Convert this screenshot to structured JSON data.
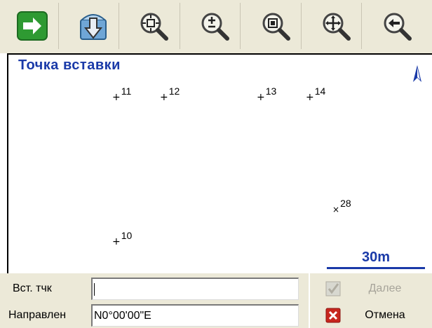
{
  "toolbar": {
    "buttons": [
      {
        "name": "next-arrow-button",
        "icon": "green-arrow-right-icon"
      },
      {
        "name": "save-download-button",
        "icon": "download-arrow-icon"
      },
      {
        "name": "zoom-extents-button",
        "icon": "zoom-extents-icon"
      },
      {
        "name": "zoom-in-out-button",
        "icon": "zoom-plus-minus-icon"
      },
      {
        "name": "zoom-window-button",
        "icon": "zoom-window-icon"
      },
      {
        "name": "pan-button",
        "icon": "pan-move-icon"
      },
      {
        "name": "back-button",
        "icon": "zoom-previous-icon"
      }
    ]
  },
  "map": {
    "title": "Точка вставки",
    "scale_label": "30m",
    "points": [
      {
        "label": "11",
        "marker": "+"
      },
      {
        "label": "12",
        "marker": "+"
      },
      {
        "label": "13",
        "marker": "+"
      },
      {
        "label": "14",
        "marker": "+"
      },
      {
        "label": "28",
        "marker": "×"
      },
      {
        "label": "10",
        "marker": "+"
      }
    ]
  },
  "form": {
    "insert_point_label": "Вст. тчк",
    "insert_point_value": "",
    "direction_label": "Направлен",
    "direction_value": "N0°00'00\"E",
    "next_label": "Далее",
    "cancel_label": "Отмена"
  },
  "colors": {
    "accent_blue": "#1a3aa8",
    "toolbar_bg": "#ece9d8",
    "cancel_red": "#c8261e",
    "next_green": "#2d9a2d"
  }
}
